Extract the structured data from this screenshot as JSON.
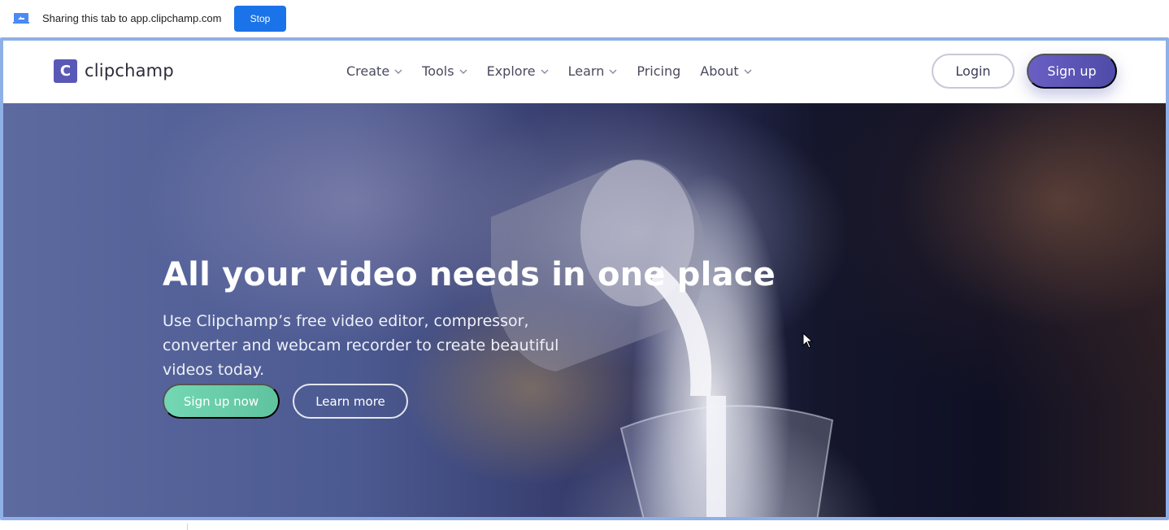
{
  "share_bar": {
    "text": "Sharing this tab to app.clipchamp.com",
    "stop_label": "Stop",
    "icon": "screen-share-icon"
  },
  "site": {
    "logo_letter": "C",
    "logo_text": "clipchamp",
    "brand_color": "#5a58b6",
    "nav": [
      {
        "label": "Create",
        "dropdown": true
      },
      {
        "label": "Tools",
        "dropdown": true
      },
      {
        "label": "Explore",
        "dropdown": true
      },
      {
        "label": "Learn",
        "dropdown": true
      },
      {
        "label": "Pricing",
        "dropdown": false
      },
      {
        "label": "About",
        "dropdown": true
      }
    ],
    "login_label": "Login",
    "signup_label": "Sign up"
  },
  "hero": {
    "title": "All your video needs in one place",
    "subtitle": "Use Clipchamp’s free video editor, compressor, converter and webcam recorder to create beautiful videos today.",
    "primary_cta": "Sign up now",
    "secondary_cta": "Learn more",
    "primary_color": "#6ccfae"
  }
}
